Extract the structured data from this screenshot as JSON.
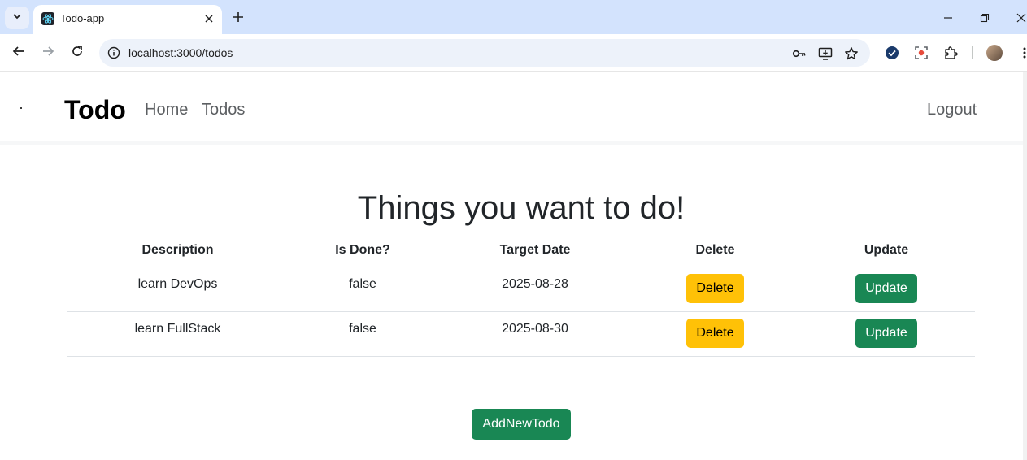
{
  "browser": {
    "tab_title": "Todo-app",
    "url": "localhost:3000/todos"
  },
  "navbar": {
    "brand": "Todo",
    "links": [
      "Home",
      "Todos"
    ],
    "logout": "Logout"
  },
  "page": {
    "heading": "Things you want to do!"
  },
  "table": {
    "headers": [
      "Description",
      "Is Done?",
      "Target Date",
      "Delete",
      "Update"
    ],
    "rows": [
      {
        "description": "learn DevOps",
        "done": "false",
        "target_date": "2025-08-28",
        "delete_label": "Delete",
        "update_label": "Update"
      },
      {
        "description": "learn FullStack",
        "done": "false",
        "target_date": "2025-08-30",
        "delete_label": "Delete",
        "update_label": "Update"
      }
    ]
  },
  "add_button": "AddNewTodo",
  "colors": {
    "delete": "#ffc107",
    "update": "#198754",
    "tabstrip": "#d3e3fd"
  }
}
